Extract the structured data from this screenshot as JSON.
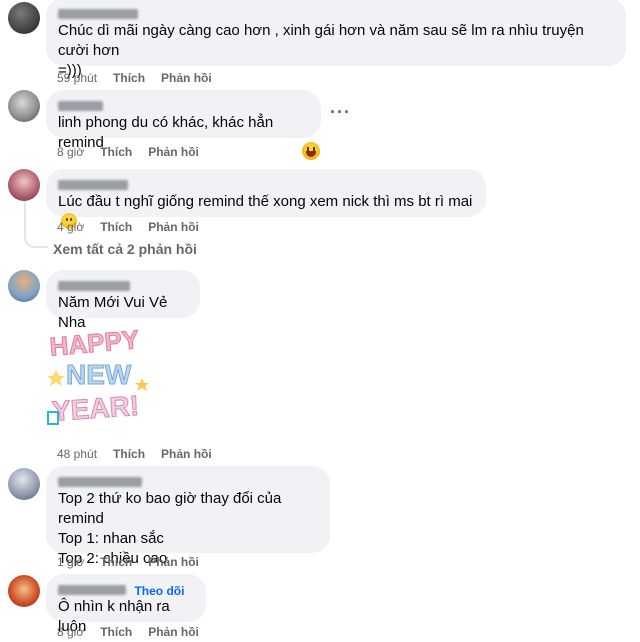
{
  "comments": [
    {
      "text_lines": [
        "Chúc dì mãi ngày càng cao hơn , xinh gái hơn và năm sau sẽ lm ra nhìu truyện cười hơn",
        "=)))"
      ],
      "time": "59 phút",
      "like": "Thích",
      "reply": "Phản hồi"
    },
    {
      "text_lines": [
        "linh phong du có khác, khác hẳn remind"
      ],
      "time": "8 giờ",
      "like": "Thích",
      "reply": "Phản hồi",
      "more": "···"
    },
    {
      "text_lines": [
        "Lúc đầu t nghĩ giống remind thế xong xem nick thì ms bt rì mai"
      ],
      "time": "4 giờ",
      "like": "Thích",
      "reply": "Phản hồi"
    },
    {
      "text_lines": [
        "Năm Mới Vui Vẻ Nha"
      ],
      "time": "48 phút",
      "like": "Thích",
      "reply": "Phản hồi",
      "sticker_lines": [
        "HAPPY",
        "NEW",
        "YEAR!"
      ]
    },
    {
      "text_lines": [
        "Top 2 thứ ko bao giờ thay đổi của remind",
        "Top 1: nhan sắc",
        "Top 2: chiều cao"
      ],
      "time": "1 giờ",
      "like": "Thích",
      "reply": "Phản hồi"
    },
    {
      "text_lines": [
        "Ô nhìn k nhận ra luôn"
      ],
      "time": "8 giờ",
      "like": "Thích",
      "reply": "Phản hồi",
      "follow": "Theo dõi"
    }
  ],
  "view_replies": "Xem tất cả 2 phản hồi",
  "icons": {
    "reaction": "haha-reaction-icon",
    "emoji": "smile-emoji-icon",
    "more": "more-options-icon"
  },
  "colors": {
    "bubble": "#f0f2f5",
    "meta": "#65676b",
    "link": "#0866ff"
  }
}
